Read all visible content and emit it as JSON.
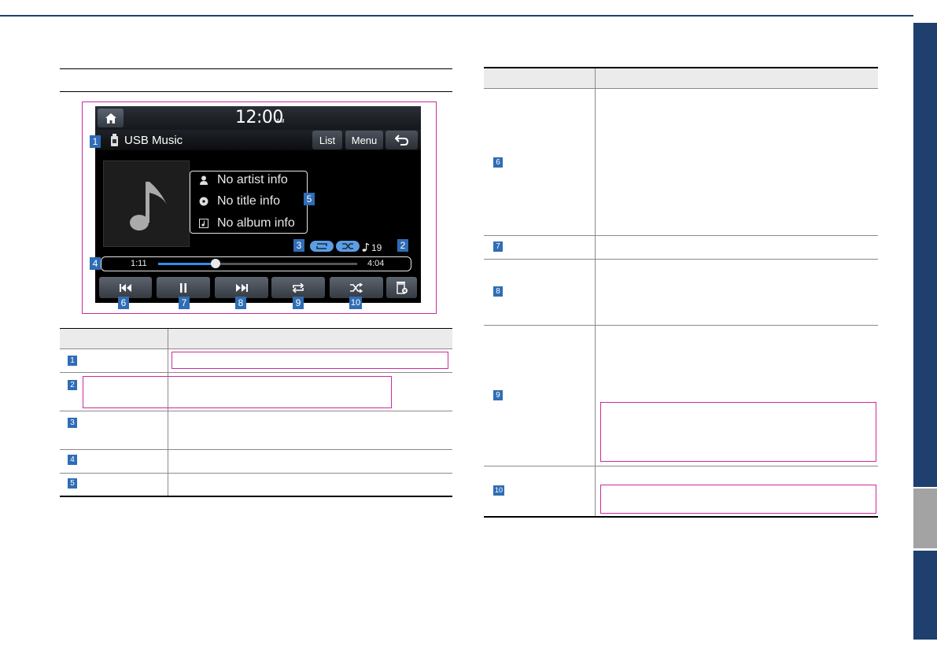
{
  "screen": {
    "clock": "12:00",
    "ampm": "AM",
    "source_label": "USB Music",
    "buttons": {
      "list": "List",
      "menu": "Menu"
    },
    "artist": "No artist info",
    "title": "No title info",
    "album": "No album info",
    "track_number": "19",
    "elapsed": "1:11",
    "duration": "4:04",
    "progress_fraction": 0.29
  },
  "callouts": {
    "c1": "1",
    "c2": "2",
    "c3": "3",
    "c4": "4",
    "c5": "5",
    "c6": "6",
    "c7": "7",
    "c8": "8",
    "c9": "9",
    "c10": "10"
  },
  "left_table": {
    "rows": [
      "1",
      "2",
      "3",
      "4",
      "5"
    ]
  },
  "right_table": {
    "rows": [
      "6",
      "7",
      "8",
      "9",
      "10"
    ]
  },
  "colors": {
    "brand_navy": "#1f3f6e",
    "badge_blue": "#2f6db5",
    "highlight_pink": "#cc2b9c",
    "progress_blue": "#2f8ee8"
  },
  "icons": [
    "home-icon",
    "back-icon",
    "usb-icon",
    "music-note-icon",
    "artist-icon",
    "title-icon",
    "album-icon",
    "repeat-icon",
    "shuffle-icon",
    "previous-icon",
    "pause-icon",
    "next-icon",
    "delete-icon"
  ]
}
